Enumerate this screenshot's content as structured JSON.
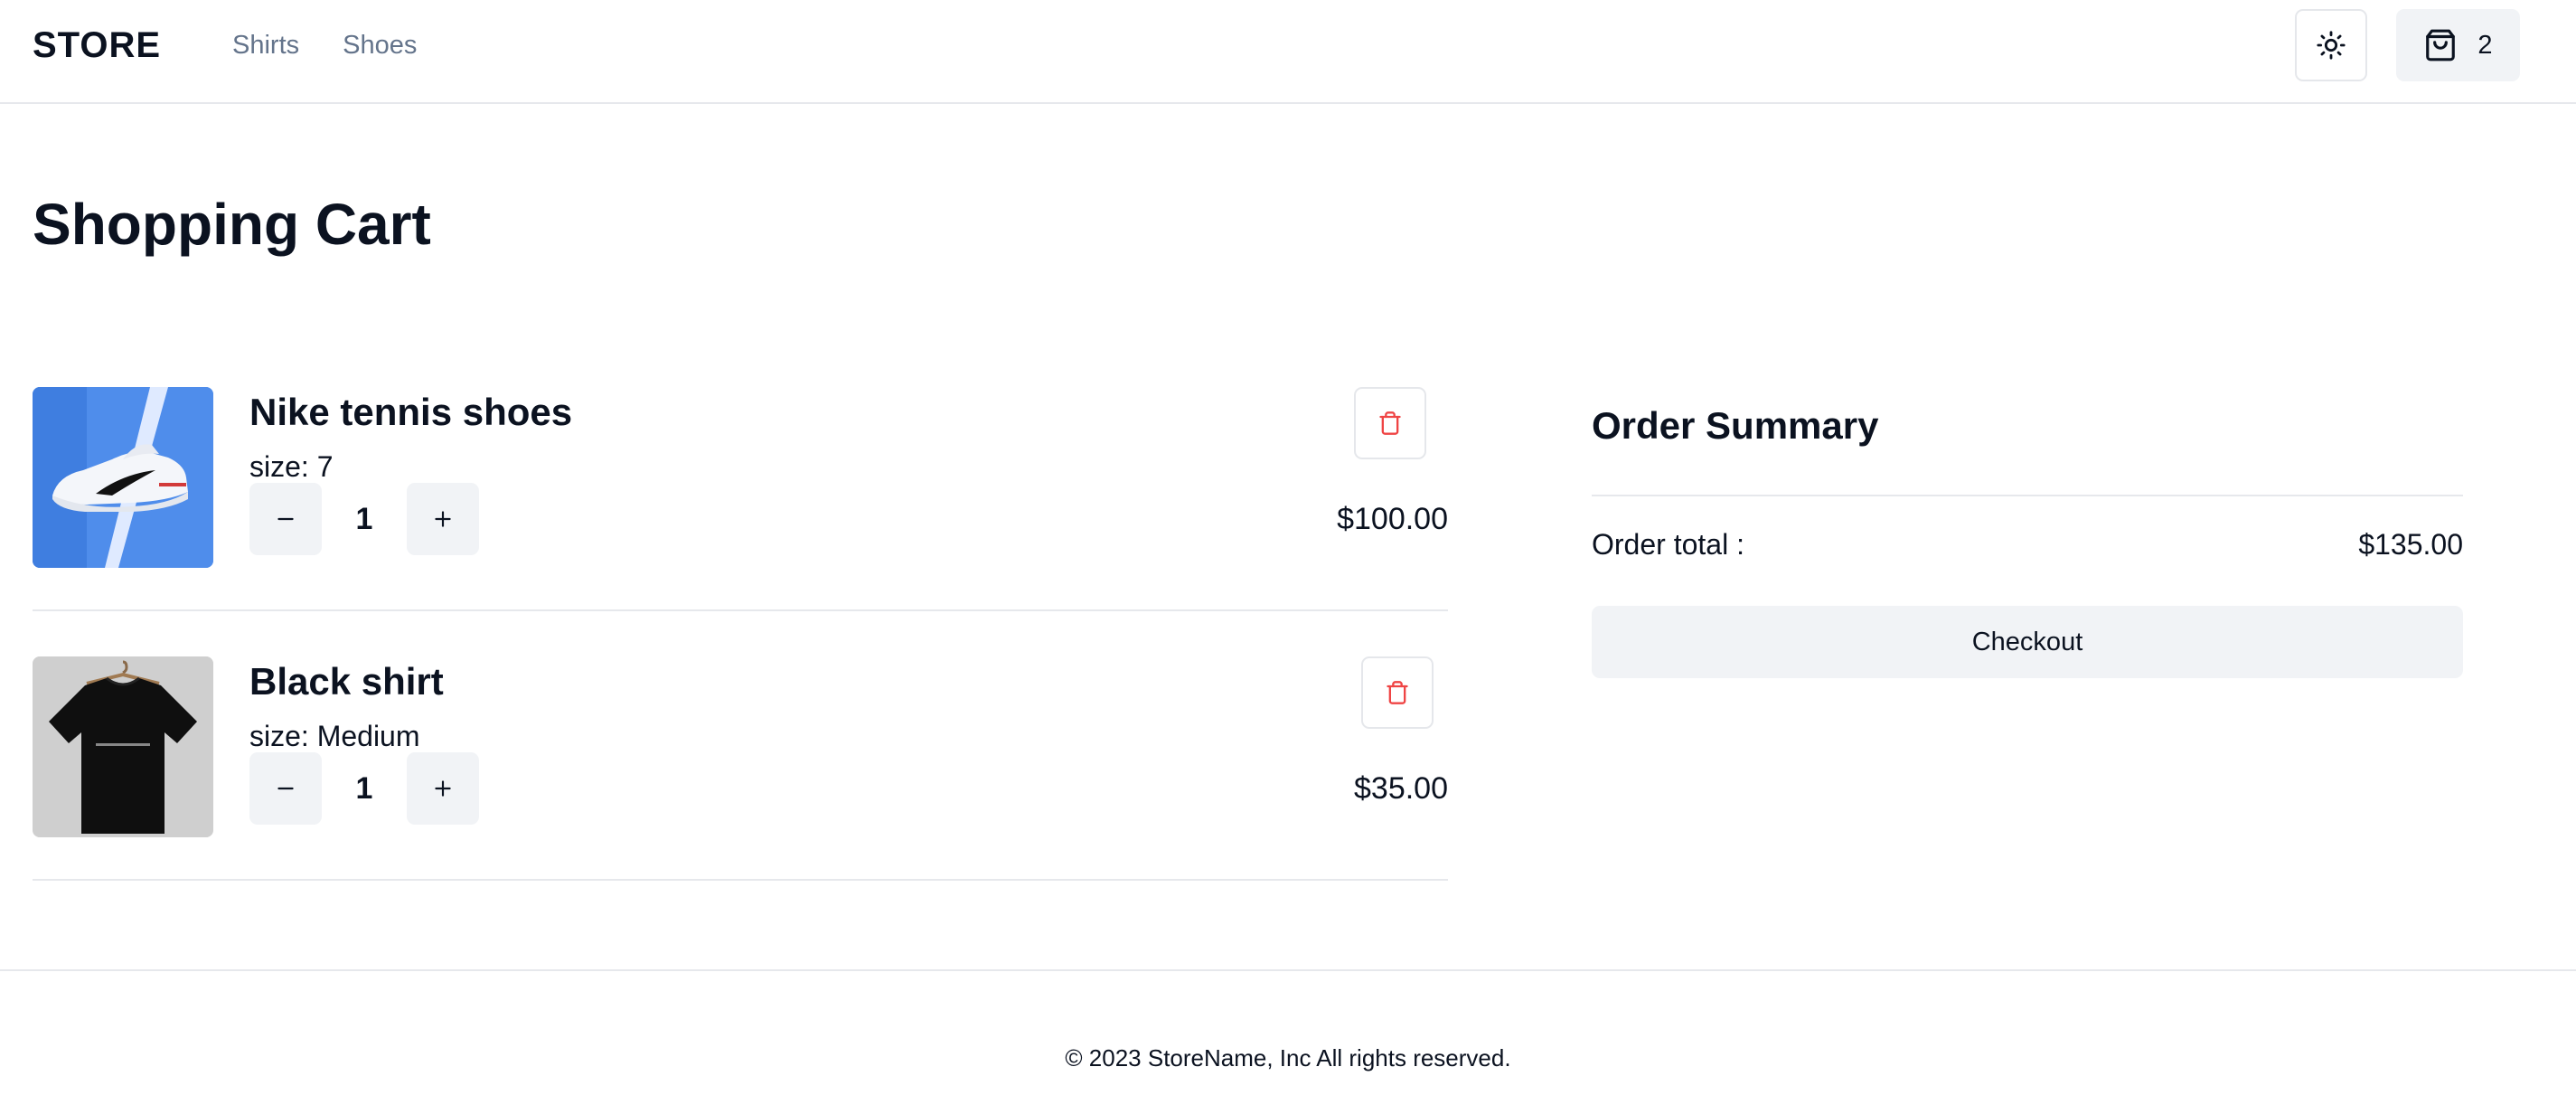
{
  "header": {
    "logo": "STORE",
    "nav": [
      "Shirts",
      "Shoes"
    ],
    "theme_icon": "sun-icon",
    "cart_icon": "shopping-bag-icon",
    "cart_count": "2"
  },
  "page_title": "Shopping Cart",
  "cart": {
    "items": [
      {
        "name": "Nike tennis shoes",
        "size_label": "size: 7",
        "quantity": "1",
        "price": "$100.00",
        "image_icon": "sneaker-photo"
      },
      {
        "name": "Black shirt",
        "size_label": "size: Medium",
        "quantity": "1",
        "price": "$35.00",
        "image_icon": "tshirt-photo"
      }
    ],
    "minus_icon": "minus-icon",
    "plus_icon": "plus-icon",
    "delete_icon": "trash-icon"
  },
  "summary": {
    "title": "Order Summary",
    "total_label": "Order total :",
    "total_value": "$135.00",
    "checkout_label": "Checkout"
  },
  "footer": {
    "text": "© 2023 StoreName, Inc All rights reserved."
  },
  "colors": {
    "text": "#0b1220",
    "muted": "#64748b",
    "button_bg": "#f1f3f6",
    "border": "#e6e8ec",
    "danger": "#ef4444"
  }
}
